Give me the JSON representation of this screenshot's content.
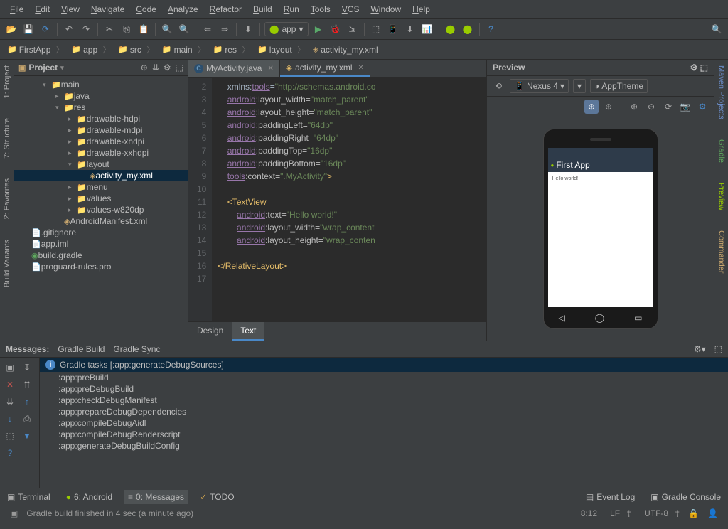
{
  "menu": [
    "File",
    "Edit",
    "View",
    "Navigate",
    "Code",
    "Analyze",
    "Refactor",
    "Build",
    "Run",
    "Tools",
    "VCS",
    "Window",
    "Help"
  ],
  "run_config": "app",
  "breadcrumb": [
    {
      "label": "FirstApp",
      "icon": "📁"
    },
    {
      "label": "app",
      "icon": "📁"
    },
    {
      "label": "src",
      "icon": "📁"
    },
    {
      "label": "main",
      "icon": "📁"
    },
    {
      "label": "res",
      "icon": "📁"
    },
    {
      "label": "layout",
      "icon": "📁"
    },
    {
      "label": "activity_my.xml",
      "icon": "◈"
    }
  ],
  "left_rail": [
    {
      "label": "1: Project"
    },
    {
      "label": "7: Structure"
    },
    {
      "label": "2: Favorites"
    },
    {
      "label": "Build Variants"
    }
  ],
  "right_rail": [
    {
      "label": "Maven Projects",
      "color": "#6a8cc7"
    },
    {
      "label": "Gradle",
      "color": "#5eab5e"
    },
    {
      "label": "Preview",
      "color": "#99cc00"
    },
    {
      "label": "Commander",
      "color": "#c9a76e"
    }
  ],
  "project_panel": {
    "title": "Project"
  },
  "tree": [
    {
      "indent": 0,
      "arrow": "▾",
      "icon": "📁",
      "label": "main"
    },
    {
      "indent": 1,
      "arrow": "▸",
      "icon": "📁",
      "label": "java"
    },
    {
      "indent": 1,
      "arrow": "▾",
      "icon": "📁",
      "label": "res"
    },
    {
      "indent": 2,
      "arrow": "▸",
      "icon": "📁",
      "label": "drawable-hdpi"
    },
    {
      "indent": 2,
      "arrow": "▸",
      "icon": "📁",
      "label": "drawable-mdpi"
    },
    {
      "indent": 2,
      "arrow": "▸",
      "icon": "📁",
      "label": "drawable-xhdpi"
    },
    {
      "indent": 2,
      "arrow": "▸",
      "icon": "📁",
      "label": "drawable-xxhdpi"
    },
    {
      "indent": 2,
      "arrow": "▾",
      "icon": "📁",
      "label": "layout"
    },
    {
      "indent": 3,
      "arrow": "",
      "icon": "◈",
      "label": "activity_my.xml",
      "selected": true
    },
    {
      "indent": 2,
      "arrow": "▸",
      "icon": "📁",
      "label": "menu"
    },
    {
      "indent": 2,
      "arrow": "▸",
      "icon": "📁",
      "label": "values"
    },
    {
      "indent": 2,
      "arrow": "▸",
      "icon": "📁",
      "label": "values-w820dp"
    },
    {
      "indent": 1,
      "arrow": "",
      "icon": "◈",
      "label": "AndroidManifest.xml"
    },
    {
      "indent": 0,
      "arrow": "",
      "icon": "📄",
      "label": ".gitignore",
      "noindent": true
    },
    {
      "indent": 0,
      "arrow": "",
      "icon": "📄",
      "label": "app.iml",
      "noindent": true,
      "color": "#6a8cc7"
    },
    {
      "indent": 0,
      "arrow": "",
      "icon": "◉",
      "label": "build.gradle",
      "noindent": true,
      "color": "#5eab5e"
    },
    {
      "indent": 0,
      "arrow": "",
      "icon": "📄",
      "label": "proguard-rules.pro",
      "noindent": true
    }
  ],
  "editor_tabs": [
    {
      "label": "MyActivity.java",
      "icon": "C",
      "active": false
    },
    {
      "label": "activity_my.xml",
      "icon": "◈",
      "active": true
    }
  ],
  "gutter_start": 2,
  "gutter_end": 17,
  "code_lines": [
    {
      "html": "    xmlns:<span class='ns'>tools</span>=<span class='str'>\"http://schemas.android.co</span>"
    },
    {
      "html": "    <span class='ns'>android</span><span class='attr'>:layout_width=</span><span class='str'>\"match_parent\"</span>"
    },
    {
      "html": "    <span class='ns'>android</span><span class='attr'>:layout_height=</span><span class='str'>\"match_parent\"</span>"
    },
    {
      "html": "    <span class='ns'>android</span><span class='attr'>:paddingLeft=</span><span class='str'>\"64dp\"</span>"
    },
    {
      "html": "    <span class='ns'>android</span><span class='attr'>:paddingRight=</span><span class='str'>\"64dp\"</span>"
    },
    {
      "html": "    <span class='ns'>android</span><span class='attr'>:paddingTop=</span><span class='str'>\"16dp\"</span>"
    },
    {
      "html": "    <span class='ns'>android</span><span class='attr'>:paddingBottom=</span><span class='str'>\"16dp\"</span>"
    },
    {
      "html": "    <span class='ns'>tools</span><span class='attr'>:context=</span><span class='str'>\".MyActivity\"</span><span class='tag'>&gt;</span>"
    },
    {
      "html": ""
    },
    {
      "html": "    <span class='tag'>&lt;TextView</span>"
    },
    {
      "html": "        <span class='ns'>android</span><span class='attr'>:text=</span><span class='str'>\"Hello world!\"</span>"
    },
    {
      "html": "        <span class='ns'>android</span><span class='attr'>:layout_width=</span><span class='str'>\"wrap_content</span>"
    },
    {
      "html": "        <span class='ns'>android</span><span class='attr'>:layout_height=</span><span class='str'>\"wrap_conten</span>"
    },
    {
      "html": ""
    },
    {
      "html": "<span class='tag'>&lt;/RelativeLayout&gt;</span>"
    },
    {
      "html": ""
    }
  ],
  "editor_bottom": {
    "design": "Design",
    "text": "Text"
  },
  "preview": {
    "title": "Preview",
    "device": "Nexus 4",
    "theme": "AppTheme",
    "app_title": "First App",
    "hello": "Hello world!"
  },
  "messages": {
    "tabs_label": "Messages:",
    "tabs": [
      "Gradle Build",
      "Gradle Sync"
    ],
    "title": "Gradle tasks [:app:generateDebugSources]",
    "lines": [
      ":app:preBuild",
      ":app:preDebugBuild",
      ":app:checkDebugManifest",
      ":app:prepareDebugDependencies",
      ":app:compileDebugAidl",
      ":app:compileDebugRenderscript",
      ":app:generateDebugBuildConfig"
    ]
  },
  "tool_windows": [
    {
      "label": "Terminal",
      "icon": "▣"
    },
    {
      "label": "6: Android",
      "icon": "●",
      "color": "#99cc00"
    },
    {
      "label": "0: Messages",
      "icon": "≡",
      "active": true
    },
    {
      "label": "TODO",
      "icon": "✓",
      "color": "#d9a94d"
    }
  ],
  "tool_windows_right": [
    {
      "label": "Event Log",
      "icon": "▤"
    },
    {
      "label": "Gradle Console",
      "icon": "▣"
    }
  ],
  "status": {
    "msg": "Gradle build finished in 4 sec (a minute ago)",
    "pos": "8:12",
    "le": "LF",
    "enc": "UTF-8"
  }
}
